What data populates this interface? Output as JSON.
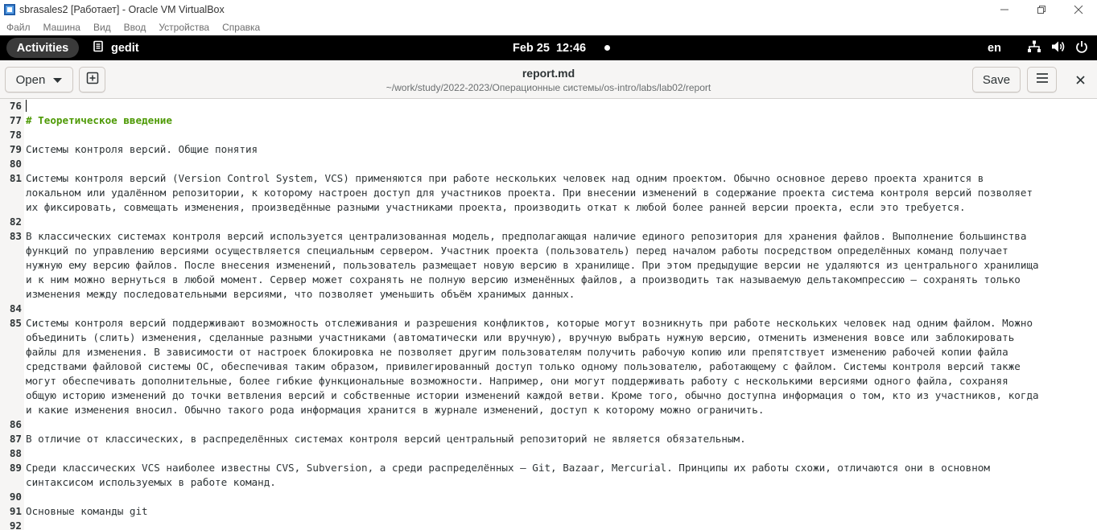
{
  "vbox": {
    "title": "sbrasales2 [Работает] - Oracle VM VirtualBox",
    "menu": [
      "Файл",
      "Машина",
      "Вид",
      "Ввод",
      "Устройства",
      "Справка"
    ]
  },
  "gnome": {
    "activities": "Activities",
    "app_name": "gedit",
    "clock": "Feb 25  12:46",
    "lang": "en",
    "icons": [
      "network-icon",
      "volume-icon",
      "power-icon",
      "battery-icon"
    ]
  },
  "headerbar": {
    "open_label": "Open",
    "save_label": "Save",
    "doc_title": "report.md",
    "doc_path": "~/work/study/2022-2023/Операционные системы/os-intro/labs/lab02/report"
  },
  "editor": {
    "lines": [
      {
        "num": "76",
        "text": [
          ""
        ],
        "cursor": true
      },
      {
        "num": "77",
        "text": [
          "# Теоретическое введение"
        ],
        "heading": true
      },
      {
        "num": "78",
        "text": [
          ""
        ]
      },
      {
        "num": "79",
        "text": [
          "Системы контроля версий. Общие понятия"
        ]
      },
      {
        "num": "80",
        "text": [
          ""
        ]
      },
      {
        "num": "81",
        "text": [
          "Системы контроля версий (Version Control System, VCS) применяются при работе нескольких человек над одним проектом. Обычно основное дерево проекта хранится в",
          "локальном или удалённом репозитории, к которому настроен доступ для участников проекта. При внесении изменений в содержание проекта система контроля версий позволяет",
          "их фиксировать, совмещать изменения, произведённые разными участниками проекта, производить откат к любой более ранней версии проекта, если это требуется."
        ]
      },
      {
        "num": "82",
        "text": [
          ""
        ]
      },
      {
        "num": "83",
        "text": [
          "В классических системах контроля версий используется централизованная модель, предполагающая наличие единого репозитория для хранения файлов. Выполнение большинства",
          "функций по управлению версиями осуществляется специальным сервером. Участник проекта (пользователь) перед началом работы посредством определённых команд получает",
          "нужную ему версию файлов. После внесения изменений, пользователь размещает новую версию в хранилище. При этом предыдущие версии не удаляются из центрального хранилища",
          "и к ним можно вернуться в любой момент. Сервер может сохранять не полную версию изменённых файлов, а производить так называемую дельтакомпрессию — сохранять только",
          "изменения между последовательными версиями, что позволяет уменьшить объём хранимых данных."
        ]
      },
      {
        "num": "84",
        "text": [
          ""
        ]
      },
      {
        "num": "85",
        "text": [
          "Системы контроля версий поддерживают возможность отслеживания и разрешения конфликтов, которые могут возникнуть при работе нескольких человек над одним файлом. Можно",
          "объединить (слить) изменения, сделанные разными участниками (автоматически или вручную), вручную выбрать нужную версию, отменить изменения вовсе или заблокировать",
          "файлы для изменения. В зависимости от настроек блокировка не позволяет другим пользователям получить рабочую копию или препятствует изменению рабочей копии файла",
          "средствами файловой системы ОС, обеспечивая таким образом, привилегированный доступ только одному пользователю, работающему с файлом. Системы контроля версий также",
          "могут обеспечивать дополнительные, более гибкие функциональные возможности. Например, они могут поддерживать работу с несколькими версиями одного файла, сохраняя",
          "общую историю изменений до точки ветвления версий и собственные истории изменений каждой ветви. Кроме того, обычно доступна информация о том, кто из участников, когда",
          "и какие изменения вносил. Обычно такого рода информация хранится в журнале изменений, доступ к которому можно ограничить."
        ]
      },
      {
        "num": "86",
        "text": [
          ""
        ]
      },
      {
        "num": "87",
        "text": [
          "В отличие от классических, в распределённых системах контроля версий центральный репозиторий не является обязательным."
        ]
      },
      {
        "num": "88",
        "text": [
          ""
        ]
      },
      {
        "num": "89",
        "text": [
          "Среди классических VCS наиболее известны CVS, Subversion, а среди распределённых — Git, Bazaar, Mercurial. Принципы их работы схожи, отличаются они в основном",
          "синтаксисом используемых в работе команд."
        ]
      },
      {
        "num": "90",
        "text": [
          ""
        ]
      },
      {
        "num": "91",
        "text": [
          "Основные команды git"
        ]
      },
      {
        "num": "92",
        "text": [
          ""
        ]
      }
    ]
  }
}
